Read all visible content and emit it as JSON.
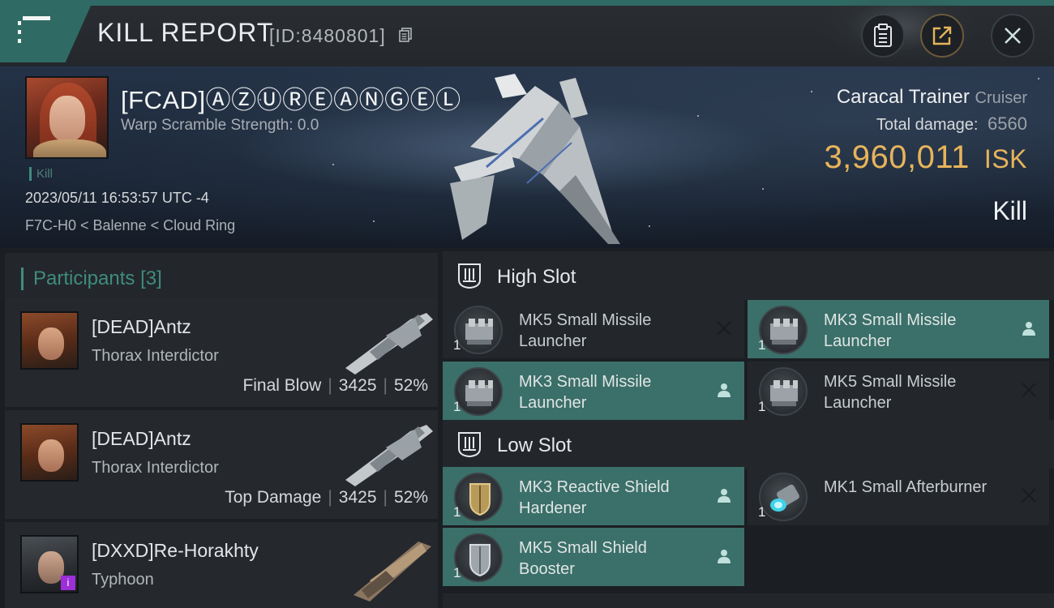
{
  "header": {
    "title": "KILL REPORT",
    "report_id": "[ID:8480801]",
    "menu_icon": "hamburger-menu-icon",
    "buttons": [
      {
        "name": "clipboard-button",
        "icon": "clipboard-icon"
      },
      {
        "name": "share-button",
        "icon": "share-icon"
      },
      {
        "name": "close-button",
        "icon": "close-icon"
      }
    ]
  },
  "victim": {
    "pilot": "[FCAD]ⒶⓏⓊⓇⒺⒶⓃⒼⒺⓁ",
    "warp_scramble": "Warp Scramble Strength: 0.0",
    "tag": "Kill",
    "timestamp": "2023/05/11 16:53:57 UTC -4",
    "location": "F7C-H0 < Balenne < Cloud Ring",
    "ship_name": "Caracal Trainer",
    "ship_class": "Cruiser",
    "total_damage_label": "Total damage:",
    "total_damage": "6560",
    "isk_value": "3,960,011",
    "isk_unit": "ISK",
    "outcome": "Kill"
  },
  "participants": {
    "title": "Participants",
    "count": "[3]",
    "rows": [
      {
        "name": "[DEAD]Antz",
        "ship": "Thorax Interdictor",
        "role": "Final Blow",
        "damage": "3425",
        "percent": "52%"
      },
      {
        "name": "[DEAD]Antz",
        "ship": "Thorax Interdictor",
        "role": "Top Damage",
        "damage": "3425",
        "percent": "52%"
      },
      {
        "name": "[DXXD]Re-Horakhty",
        "ship": "Typhoon",
        "badge": "i"
      }
    ]
  },
  "fitting": {
    "high_slot_label": "High Slot",
    "low_slot_label": "Low Slot",
    "high": [
      {
        "name": "MK5 Small Missile Launcher",
        "qty": "1",
        "status_icon": "destroyed-x-icon",
        "active": false
      },
      {
        "name": "MK3 Small Missile Launcher",
        "qty": "1",
        "status_icon": "dropped-person-icon",
        "active": true
      },
      {
        "name": "MK3 Small Missile Launcher",
        "qty": "1",
        "status_icon": "dropped-person-icon",
        "active": true
      },
      {
        "name": "MK5 Small Missile Launcher",
        "qty": "1",
        "status_icon": "destroyed-x-icon",
        "active": false
      }
    ],
    "low": [
      {
        "name": "MK3 Reactive Shield Hardener",
        "qty": "1",
        "status_icon": "dropped-person-icon",
        "active": true
      },
      {
        "name": "MK1 Small Afterburner",
        "qty": "1",
        "status_icon": "destroyed-x-icon",
        "active": false
      },
      {
        "name": "MK5 Small Shield Booster",
        "qty": "1",
        "status_icon": "dropped-person-icon",
        "active": true
      }
    ]
  },
  "colors": {
    "accent": "#3f8c7f",
    "active_module": "#3b6f69",
    "isk": "#e7b45a"
  }
}
